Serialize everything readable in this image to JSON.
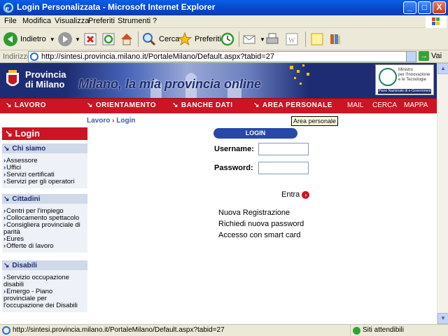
{
  "window": {
    "title": "Login Personalizzata - Microsoft Internet Explorer",
    "controls": [
      "_",
      "□",
      "X"
    ]
  },
  "menu": {
    "items": [
      "File",
      "Modifica",
      "Visualizza",
      "Preferiti",
      "Strumenti",
      "?"
    ]
  },
  "toolbar": {
    "back_label": "Indietro",
    "search_label": "Cerca",
    "favorites_label": "Preferiti"
  },
  "address": {
    "label": "Indirizzo",
    "url": "http://sintesi.provincia.milano.it/PortaleMilano/Default.aspx?tabid=27",
    "go_label": "Vai"
  },
  "banner": {
    "org_line1": "Provincia",
    "org_line2": "di Milano",
    "slogan": "Milano, la mia provincia online",
    "ministry_text": [
      "Ministro",
      "per l'Innovazione",
      "e le Tecnologie"
    ],
    "ministry_band": "Piano Nazionale di e-Government"
  },
  "nav": {
    "items": [
      "LAVORO",
      "ORIENTAMENTO",
      "BANCHE DATI",
      "AREA PERSONALE"
    ],
    "links": [
      "MAIL",
      "CERCA",
      "MAPPA"
    ],
    "tooltip": "Area personale"
  },
  "breadcrumb": {
    "parent": "Lavoro",
    "separator": "›",
    "current": "Login"
  },
  "sidebar": {
    "title": "Login",
    "sections": [
      {
        "title": "Chi siamo",
        "items": [
          "Assessore",
          "Uffici",
          "Servizi certificati",
          "Servizi per gli operatori"
        ]
      },
      {
        "title": "Cittadini",
        "items": [
          "Centri per l'impiego",
          "Collocamento spettacolo",
          "Consigliera provinciale di parità",
          "Eures",
          "Offerte di lavoro"
        ]
      },
      {
        "title": "Disabili",
        "items": [
          "Servizio occupazione disabili",
          "Emergo - Piano provinciale per l'occupazione dei Disabili"
        ]
      }
    ]
  },
  "login": {
    "header": "LOGIN",
    "username_label": "Username:",
    "password_label": "Password:",
    "username_value": "",
    "password_value": "",
    "submit_label": "Entra",
    "links": [
      "Nuova Registrazione",
      "Richiedi nuova password",
      "Accesso con smart card"
    ]
  },
  "status": {
    "url": "http://sintesi.provincia.milano.it/PortaleMilano/Default.aspx?tabid=27",
    "zone": "Siti attendibili"
  },
  "colors": {
    "nav_red": "#cc1424",
    "banner_blue": "#1e2d73",
    "login_blue": "#2848a8"
  }
}
